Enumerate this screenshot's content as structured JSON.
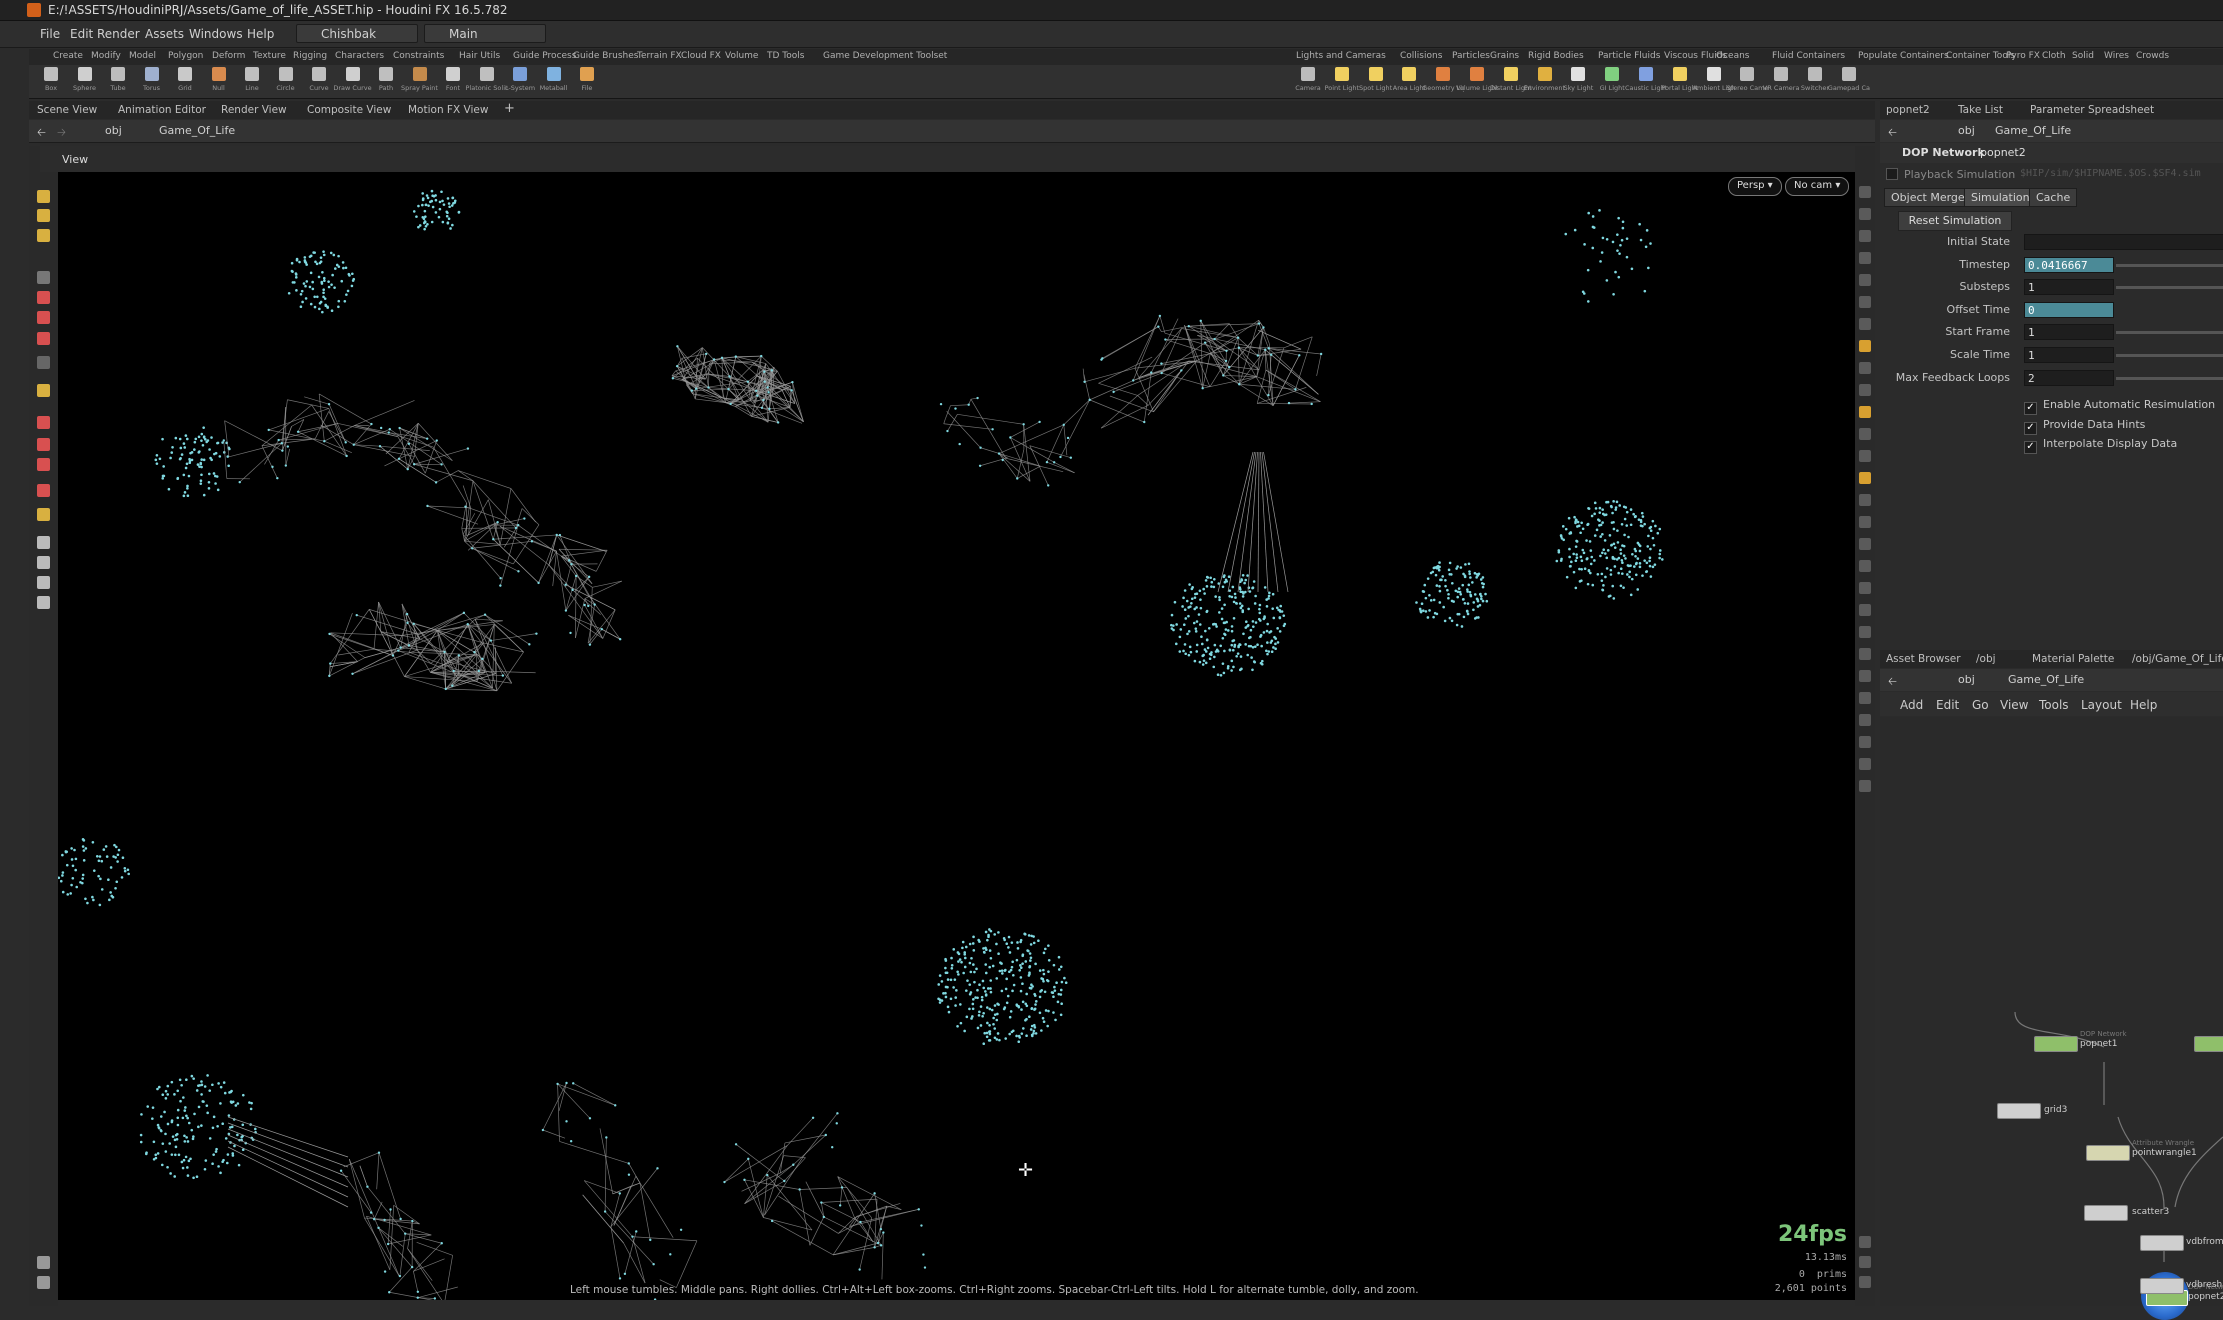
{
  "window": {
    "title": "E:/!ASSETS/HoudiniPRJ/Assets/Game_of_life_ASSET.hip - Houdini FX 16.5.782"
  },
  "menu": {
    "items": [
      "File",
      "Edit",
      "Render",
      "Assets",
      "Windows",
      "Help"
    ],
    "desktop": "Chishbak",
    "context": "Main"
  },
  "shelf_left": {
    "tabs": [
      "Create",
      "Modify",
      "Model",
      "Polygon",
      "Deform",
      "Texture",
      "Rigging",
      "Characters",
      "Constraints",
      "Hair Utils",
      "Guide Process",
      "Guide Brushes",
      "Terrain FX",
      "Cloud FX",
      "Volume",
      "TD Tools",
      "Game Development Toolset"
    ],
    "tools": [
      "Box",
      "Sphere",
      "Tube",
      "Torus",
      "Grid",
      "Null",
      "Line",
      "Circle",
      "Curve",
      "Draw Curve",
      "Path",
      "Spray Paint",
      "Font",
      "Platonic Solids",
      "L-System",
      "Metaball",
      "File"
    ]
  },
  "shelf_right": {
    "tabs": [
      "Lights and Cameras",
      "Collisions",
      "Particles",
      "Grains",
      "Rigid Bodies",
      "Particle Fluids",
      "Viscous Fluids",
      "Oceans",
      "Fluid Containers",
      "Populate Containers",
      "Container Tools",
      "Pyro FX",
      "Cloth",
      "Solid",
      "Wires",
      "Crowds"
    ],
    "tools": [
      "Camera",
      "Point Light",
      "Spot Light",
      "Area Light",
      "Geometry Light",
      "Volume Light",
      "Distant Light",
      "Environment Light",
      "Sky Light",
      "GI Light",
      "Caustic Light",
      "Portal Light",
      "Ambient Light",
      "Stereo Camera",
      "VR Camera",
      "Switcher",
      "Gamepad Camera"
    ]
  },
  "scene_tabs": [
    "Scene View",
    "Animation Editor",
    "Render View",
    "Composite View",
    "Motion FX View"
  ],
  "scene_path": {
    "root": "obj",
    "node": "Game_Of_Life"
  },
  "viewport": {
    "label": "View",
    "persp": "Persp ▾",
    "cam": "No cam ▾",
    "fps": "24fps",
    "frame_time": "13.13ms",
    "prims": "0  prims",
    "points": "2,601 points",
    "hint": "Left mouse tumbles. Middle pans. Right dollies. Ctrl+Alt+Left box-zooms. Ctrl+Right zooms. Spacebar-Ctrl-Left tilts. Hold L for alternate tumble, dolly, and zoom."
  },
  "param_panel": {
    "tabs": [
      "popnet2",
      "Take List",
      "Parameter Spreadsheet"
    ],
    "path": {
      "root": "obj",
      "node": "Game_Of_Life"
    },
    "node_type": "DOP Network",
    "node_name": "popnet2",
    "playback_label": "Playback Simulation",
    "playback_path": "$HIP/sim/$HIPNAME.$OS.$SF4.sim",
    "subtabs": [
      "Object Merge",
      "Simulation",
      "Cache"
    ],
    "reset_button": "Reset Simulation",
    "parms": [
      {
        "label": "Initial State",
        "value": "",
        "hl": false,
        "slider": false
      },
      {
        "label": "Timestep",
        "value": "0.0416667",
        "hl": true,
        "slider": true
      },
      {
        "label": "Substeps",
        "value": "1",
        "hl": false,
        "slider": true
      },
      {
        "label": "Offset Time",
        "value": "0",
        "hl": true,
        "slider": false
      },
      {
        "label": "Start Frame",
        "value": "1",
        "hl": false,
        "slider": true
      },
      {
        "label": "Scale Time",
        "value": "1",
        "hl": false,
        "slider": true
      },
      {
        "label": "Max Feedback Loops",
        "value": "2",
        "hl": false,
        "slider": true
      }
    ],
    "checkboxes": [
      "Enable Automatic Resimulation",
      "Provide Data Hints",
      "Interpolate Display Data"
    ]
  },
  "network_panel": {
    "tabs": [
      "Asset Browser",
      "/obj",
      "Material Palette",
      "/obj/Game_Of_Life"
    ],
    "path": {
      "root": "obj",
      "node": "Game_Of_Life"
    },
    "menu": [
      "Add",
      "Edit",
      "Go",
      "View",
      "Tools",
      "Layout",
      "Help"
    ],
    "nodes": [
      {
        "name": "popnet1",
        "type": "DOP Network"
      },
      {
        "name": "grid3",
        "type": ""
      },
      {
        "name": "pointwrangle1",
        "type": "Attribute Wrangle"
      },
      {
        "name": "scatter3",
        "type": ""
      },
      {
        "name": "popnet2",
        "type": "DOP Network"
      },
      {
        "name": "vdbfrom",
        "type": ""
      },
      {
        "name": "vdbreshi",
        "type": ""
      }
    ]
  },
  "colors": {
    "accent": "#4b8a97",
    "points": "#7fd8e0",
    "wire": "#9a9a9a",
    "fps": "#7cc47a"
  }
}
